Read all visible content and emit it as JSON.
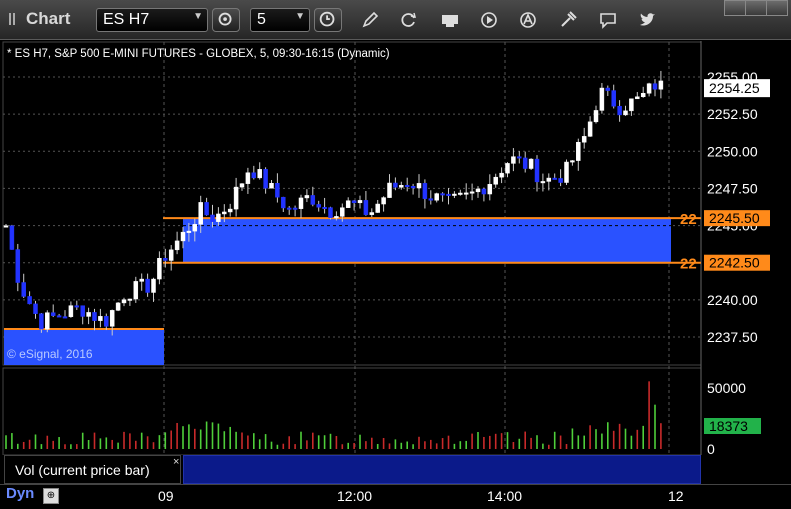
{
  "window": {
    "title": "Chart"
  },
  "toolbar": {
    "symbol": "ES H7",
    "interval": "5",
    "icons": [
      "crosshair-gear-icon",
      "clock-icon",
      "pencil-icon",
      "refresh-icon",
      "get-icon",
      "play-icon",
      "alert-icon",
      "settings-icon",
      "comment-icon",
      "twitter-icon"
    ]
  },
  "chart": {
    "info_line": "* ES H7, S&P 500 E-MINI FUTURES - GLOBEX, 5, 09:30-16:15 (Dynamic)",
    "watermark": "© eSignal, 2016",
    "price_axis_labels": [
      "2255.00",
      "2252.50",
      "2250.00",
      "2247.50",
      "2245.00",
      "2240.00",
      "2237.50"
    ],
    "current_price": "2254.25",
    "zone_top_price": "2245.50",
    "zone_bottom_price": "2242.50",
    "zone_marker_text": "22",
    "colors": {
      "zone_fill": "#2a52ff",
      "zone_border": "#ff8a1a",
      "candle_up": "#ffffff",
      "candle_down": "#2233ff",
      "wick": "#cccccc",
      "grid": "#555555",
      "volume_up": "#4fcf3a",
      "volume_down": "#c82a2a",
      "volume_label_bg": "#22b24a"
    }
  },
  "volume": {
    "axis_labels": [
      "50000",
      "0"
    ],
    "current_value": "18373",
    "study_label": "Vol (current price bar)",
    "close_symbol": "×"
  },
  "time_axis": {
    "labels": [
      "09",
      "12:00",
      "14:00",
      "12"
    ],
    "mode_label": "Dyn"
  }
}
